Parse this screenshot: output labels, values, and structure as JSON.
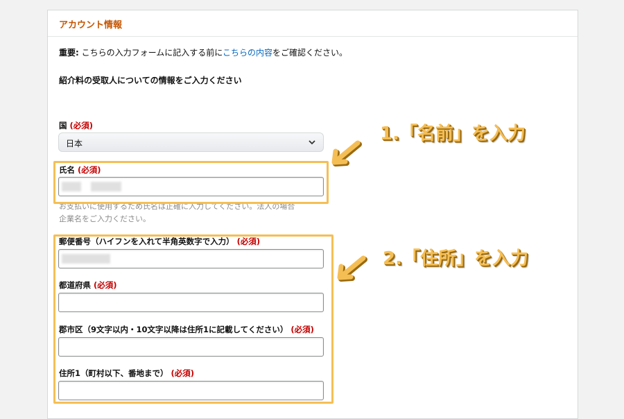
{
  "section": {
    "title": "アカウント情報"
  },
  "notice": {
    "prefix": "重要:",
    "before": " こちらの入力フォームに記入する前に",
    "link": "こちらの内容",
    "after": "をご確認ください。"
  },
  "heading": "紹介料の受取人についての情報をご入力ください",
  "required_mark": "(必須)",
  "fields": {
    "country": {
      "label": "国 ",
      "value": "日本"
    },
    "name": {
      "label": "氏名 ",
      "help": "お支払いに使用するため氏名は正確に入力してください。法人の場合",
      "help2": "企業名をご入力ください。"
    },
    "postal": {
      "label": "郵便番号（ハイフンを入れて半角英数字で入力） "
    },
    "prefecture": {
      "label": "都道府県 "
    },
    "city": {
      "label": "郡市区（9文字以内・10文字以降は住所1に記載してください） "
    },
    "address1": {
      "label": "住所1（町村以下、番地まで） "
    }
  },
  "annotations": {
    "step1": "1.「名前」を入力",
    "step2": "2.「住所」を入力"
  },
  "colors": {
    "accent": "#c45500",
    "required": "#c40000",
    "link": "#0066c0",
    "highlight": "#f5be55"
  }
}
